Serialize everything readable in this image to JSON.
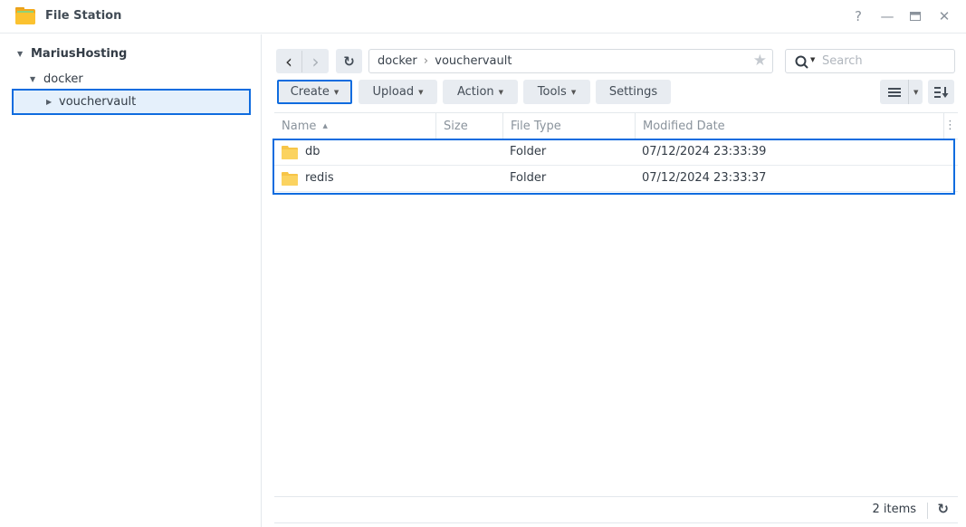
{
  "window": {
    "title": "File Station",
    "controls": {
      "help": "?",
      "minimize": "—",
      "maximize": "▭",
      "close": "✕"
    }
  },
  "sidebar": {
    "tree": [
      {
        "label": "MariusHosting",
        "level": 0,
        "expanded": true
      },
      {
        "label": "docker",
        "level": 1,
        "expanded": true
      },
      {
        "label": "vouchervault",
        "level": 2,
        "expanded": false,
        "selected": true
      }
    ]
  },
  "toolbar": {
    "back_icon": "‹",
    "forward_icon": "›",
    "refresh_icon": "↻",
    "path": {
      "segments": [
        "docker",
        "vouchervault"
      ],
      "separator": "›"
    },
    "search_placeholder": "Search",
    "buttons": {
      "create": "Create",
      "upload": "Upload",
      "action": "Action",
      "tools": "Tools",
      "settings": "Settings"
    }
  },
  "table": {
    "columns": [
      "Name",
      "Size",
      "File Type",
      "Modified Date"
    ],
    "sort_indicator": "▲",
    "rows": [
      {
        "name": "db",
        "size": "",
        "type": "Folder",
        "modified": "07/12/2024 23:33:39"
      },
      {
        "name": "redis",
        "size": "",
        "type": "Folder",
        "modified": "07/12/2024 23:33:37"
      }
    ]
  },
  "footer": {
    "count": "2 items"
  },
  "colors": {
    "accent": "#0f6cdf",
    "folder": "#f7c548",
    "button_bg": "#e8ecf1"
  }
}
